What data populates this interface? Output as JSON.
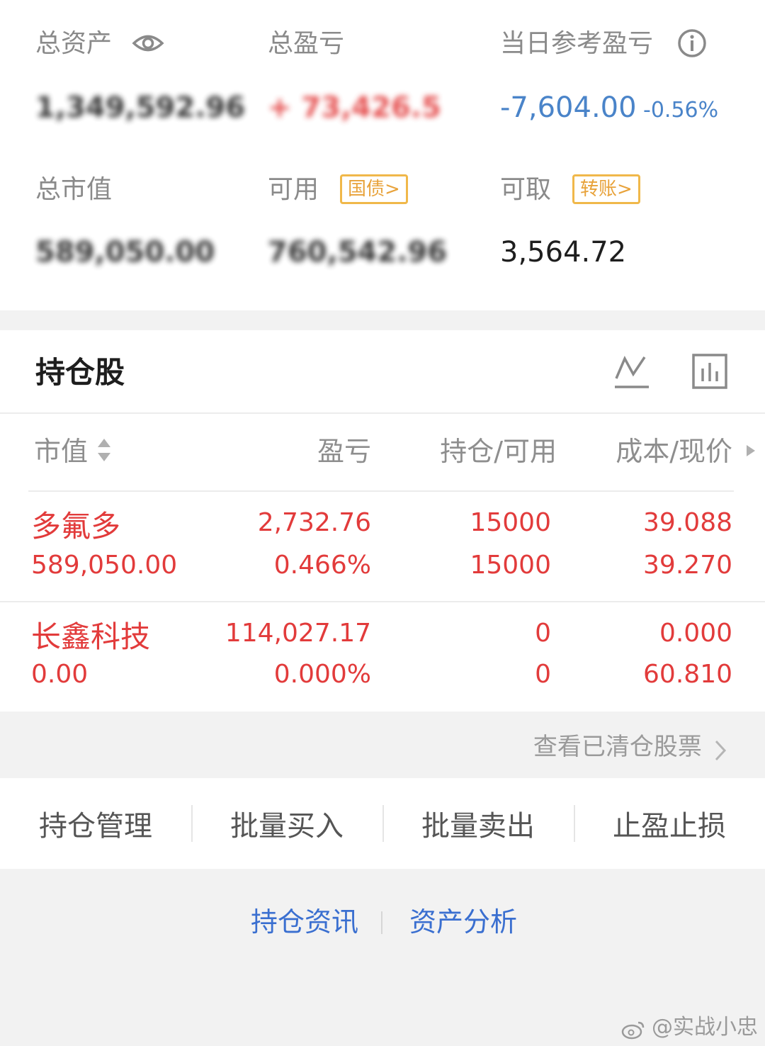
{
  "summary": {
    "total_assets_label": "总资产",
    "total_assets_value": "1,349,592.96",
    "total_pnl_label": "总盈亏",
    "total_pnl_value": "+ 73,426.5",
    "daily_pnl_label": "当日参考盈亏",
    "daily_pnl_value": "-7,604.00",
    "daily_pnl_pct": "-0.56%",
    "market_value_label": "总市值",
    "market_value_value": "589,050.00",
    "available_label": "可用",
    "available_value": "760,542.96",
    "bond_tag": "国债>",
    "withdrawable_label": "可取",
    "withdrawable_value": "3,564.72",
    "transfer_tag": "转账>"
  },
  "holdings": {
    "title": "持仓股",
    "columns": {
      "market_value": "市值",
      "pnl": "盈亏",
      "position": "持仓/可用",
      "cost_price": "成本/现价"
    },
    "rows": [
      {
        "name": "多氟多",
        "market_value": "589,050.00",
        "pnl": "2,732.76",
        "pnl_pct": "0.466%",
        "position": "15000",
        "available": "15000",
        "cost": "39.088",
        "price": "39.270"
      },
      {
        "name": "长鑫科技",
        "market_value": "0.00",
        "pnl": "114,027.17",
        "pnl_pct": "0.000%",
        "position": "0",
        "available": "0",
        "cost": "0.000",
        "price": "60.810"
      }
    ],
    "cleared_link": "查看已清仓股票"
  },
  "actions": [
    "持仓管理",
    "批量买入",
    "批量卖出",
    "止盈止损"
  ],
  "links": [
    "持仓资讯",
    "资产分析"
  ],
  "watermark": "@实战小忠",
  "colors": {
    "red": "#e23b3b",
    "blue": "#4a84c9",
    "tag_orange": "#e8a23a",
    "link_blue": "#3a6fd0"
  }
}
